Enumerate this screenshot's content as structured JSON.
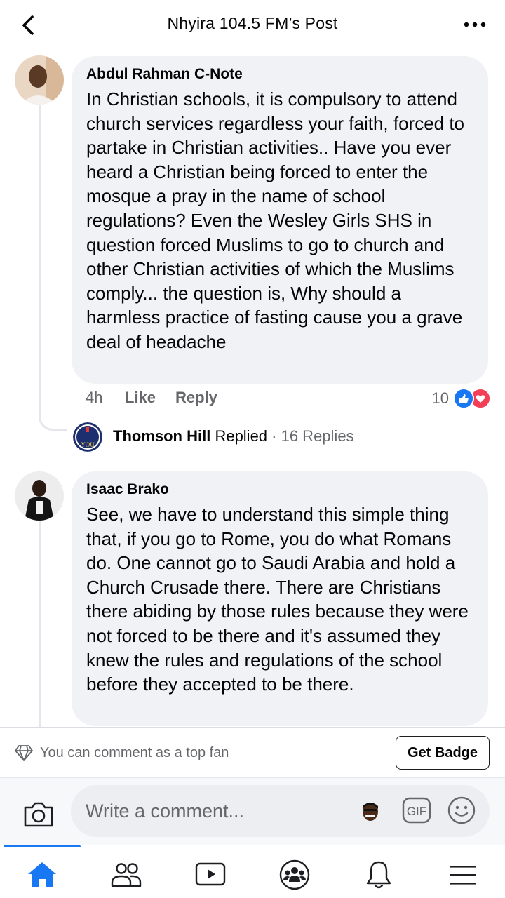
{
  "header": {
    "title": "Nhyira 104.5 FM’s Post",
    "back_icon": "chevron-left-icon",
    "more_icon": "more-horizontal-icon"
  },
  "comments": [
    {
      "author": "Abdul Rahman C-Note",
      "text": "In Christian schools, it is compulsory to attend church services regardless your faith, forced to partake in Christian activities.. Have you ever heard a Christian being forced to enter the mosque a pray in the name of school regulations?  Even the Wesley Girls SHS in question forced Muslims to go to church and other Christian activities of which the Muslims comply... the question is, Why should a harmless practice of fasting cause you a grave deal of headache",
      "time": "4h",
      "like_label": "Like",
      "reply_label": "Reply",
      "reaction_count": "10",
      "reply_summary": {
        "name": "Thomson Hill",
        "action": " Replied",
        "count": " · 16 Replies"
      }
    },
    {
      "author": "Isaac Brako",
      "text": "See, we have to understand this simple thing that, if you go to Rome, you do what Romans do. One cannot go to Saudi Arabia and hold a Church Crusade there. There are Christians there abiding by those rules because they were not forced to be there and it's assumed they knew the rules and regulations of the school before they accepted to be there."
    }
  ],
  "fan_bar": {
    "text": "You can comment as a top fan",
    "button_label": "Get Badge"
  },
  "composer": {
    "placeholder": "Write a comment...",
    "gif_label": "GIF"
  },
  "nav": {
    "items": [
      "home-icon",
      "friends-icon",
      "watch-icon",
      "groups-icon",
      "notifications-icon",
      "menu-icon"
    ],
    "active": "home-icon"
  },
  "colors": {
    "accent": "#1877f2",
    "love": "#f33e58",
    "bubble": "#f0f2f5",
    "secondary_text": "#65676b"
  }
}
